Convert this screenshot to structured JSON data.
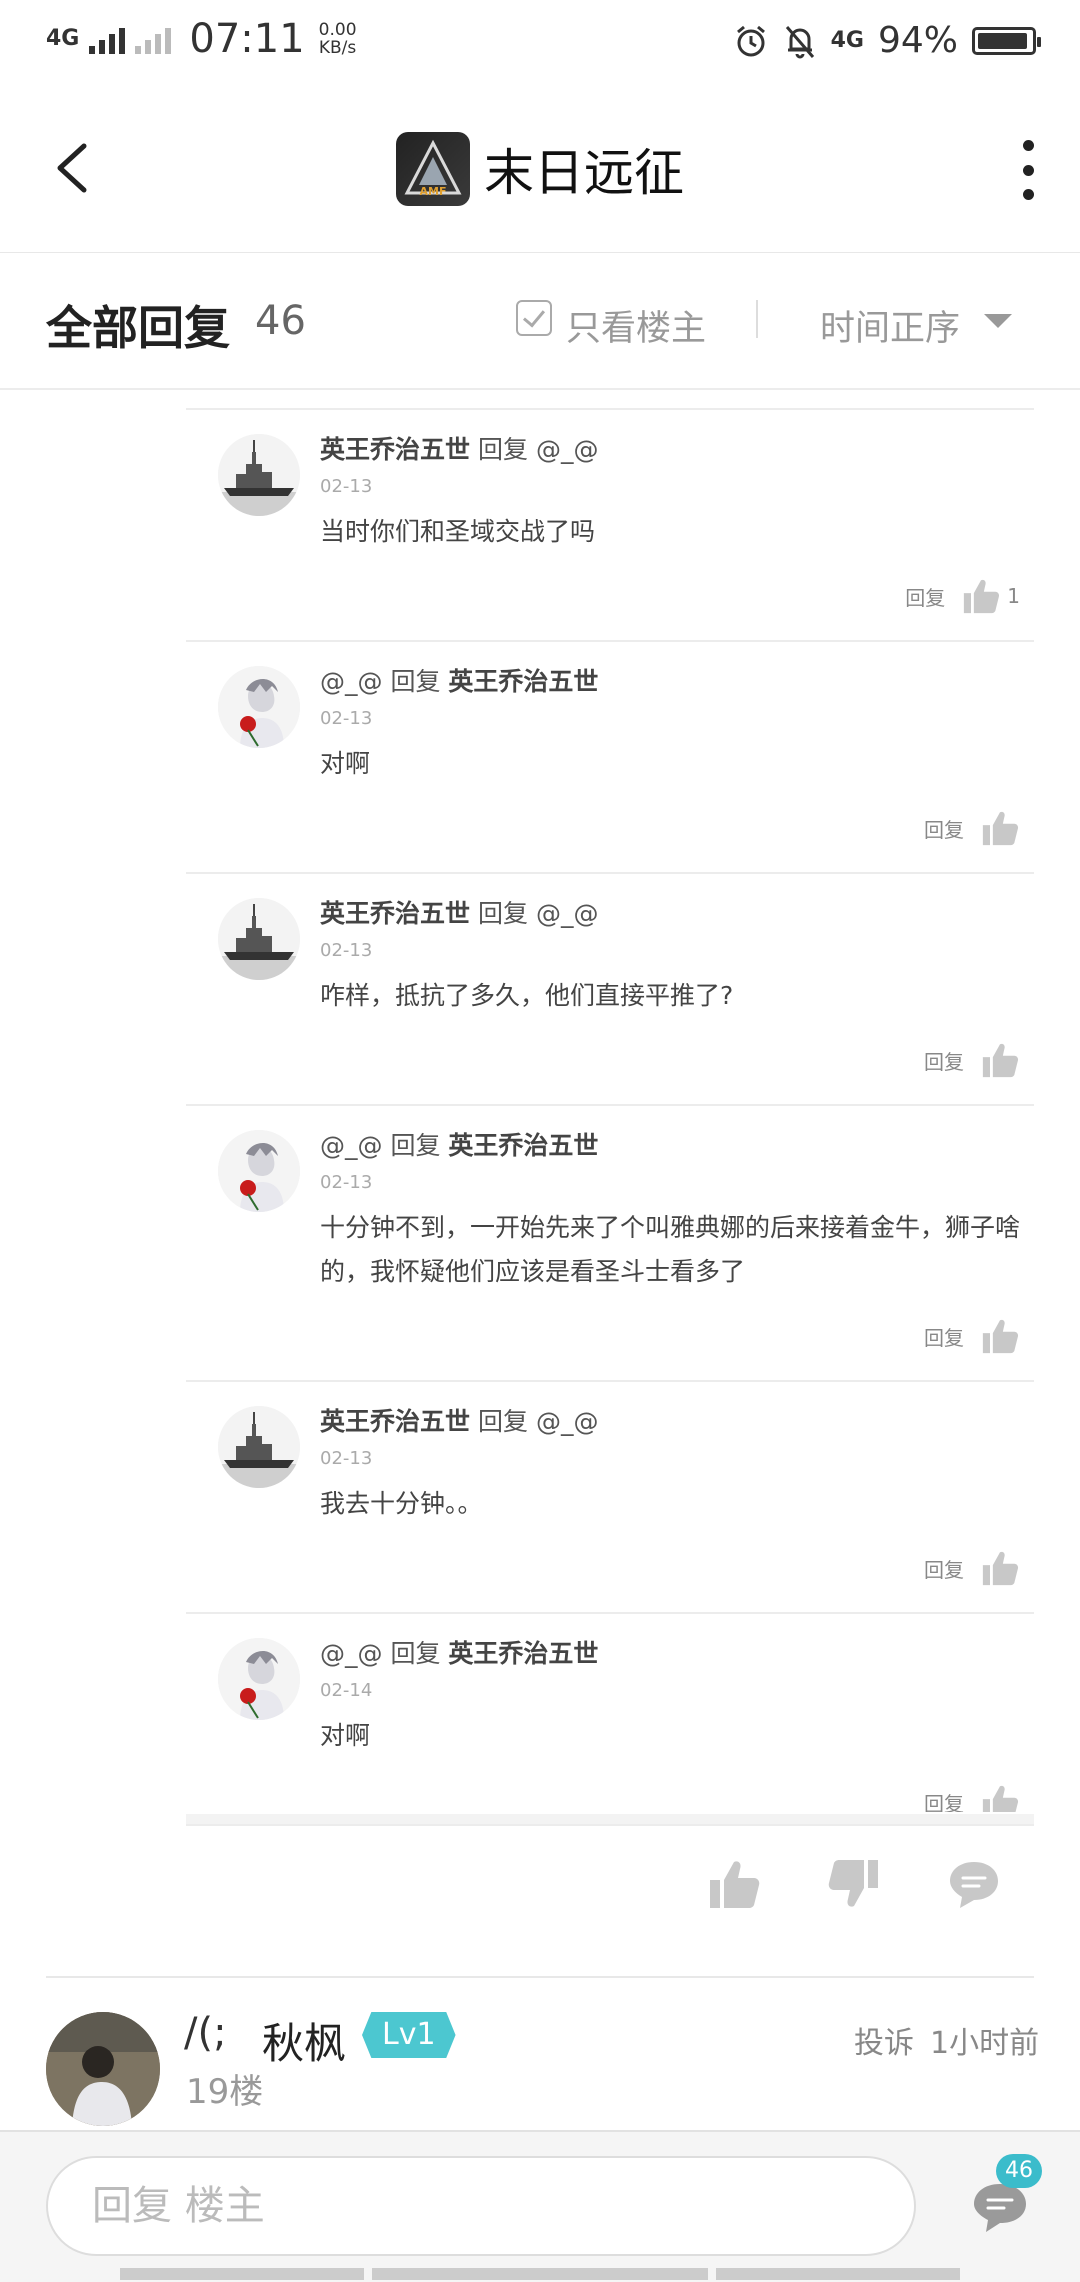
{
  "status_bar": {
    "network": "4G",
    "time": "07:11",
    "speed_value": "0.00",
    "speed_unit": "KB/s",
    "network2": "4G",
    "battery": "94%",
    "battery_level": 0.94
  },
  "header": {
    "title": "末日远征",
    "logo_text": "AMF"
  },
  "filter": {
    "title": "全部回复",
    "count": "46",
    "only_author": "只看楼主",
    "sort": "时间正序"
  },
  "replies": [
    {
      "author": "英王乔治五世",
      "reply_word": "回复",
      "target": "@_@",
      "bold_first": true,
      "date": "02-13",
      "text": "当时你们和圣域交战了吗",
      "reply_label": "回复",
      "likes": "1",
      "avatar": "ship"
    },
    {
      "author": "@_@",
      "reply_word": "回复",
      "target": "英王乔治五世",
      "bold_first": false,
      "date": "02-13",
      "text": "对啊",
      "reply_label": "回复",
      "likes": "",
      "avatar": "rose"
    },
    {
      "author": "英王乔治五世",
      "reply_word": "回复",
      "target": "@_@",
      "bold_first": true,
      "date": "02-13",
      "text": "咋样，抵抗了多久，他们直接平推了?",
      "reply_label": "回复",
      "likes": "",
      "avatar": "ship"
    },
    {
      "author": "@_@",
      "reply_word": "回复",
      "target": "英王乔治五世",
      "bold_first": false,
      "date": "02-13",
      "text": "十分钟不到，一开始先来了个叫雅典娜的后来接着金牛，狮子啥的，我怀疑他们应该是看圣斗士看多了",
      "reply_label": "回复",
      "likes": "",
      "avatar": "rose"
    },
    {
      "author": "英王乔治五世",
      "reply_word": "回复",
      "target": "@_@",
      "bold_first": true,
      "date": "02-13",
      "text": "我去十分钟。。",
      "reply_label": "回复",
      "likes": "",
      "avatar": "ship"
    },
    {
      "author": "@_@",
      "reply_word": "回复",
      "target": "英王乔治五世",
      "bold_first": false,
      "date": "02-14",
      "text": "对啊",
      "reply_label": "回复",
      "likes": "",
      "avatar": "rose"
    }
  ],
  "floor": {
    "signature": "/(;",
    "name": "秋枫",
    "level": "Lv1",
    "floor_number": "19楼",
    "report": "投诉",
    "time": "1小时前"
  },
  "bottom": {
    "input_placeholder": "回复  楼主",
    "comment_count": "46"
  },
  "colors": {
    "accent": "#3bbccb",
    "level_badge": "#4cc7d0",
    "icon_gray": "#c8c8c8"
  }
}
